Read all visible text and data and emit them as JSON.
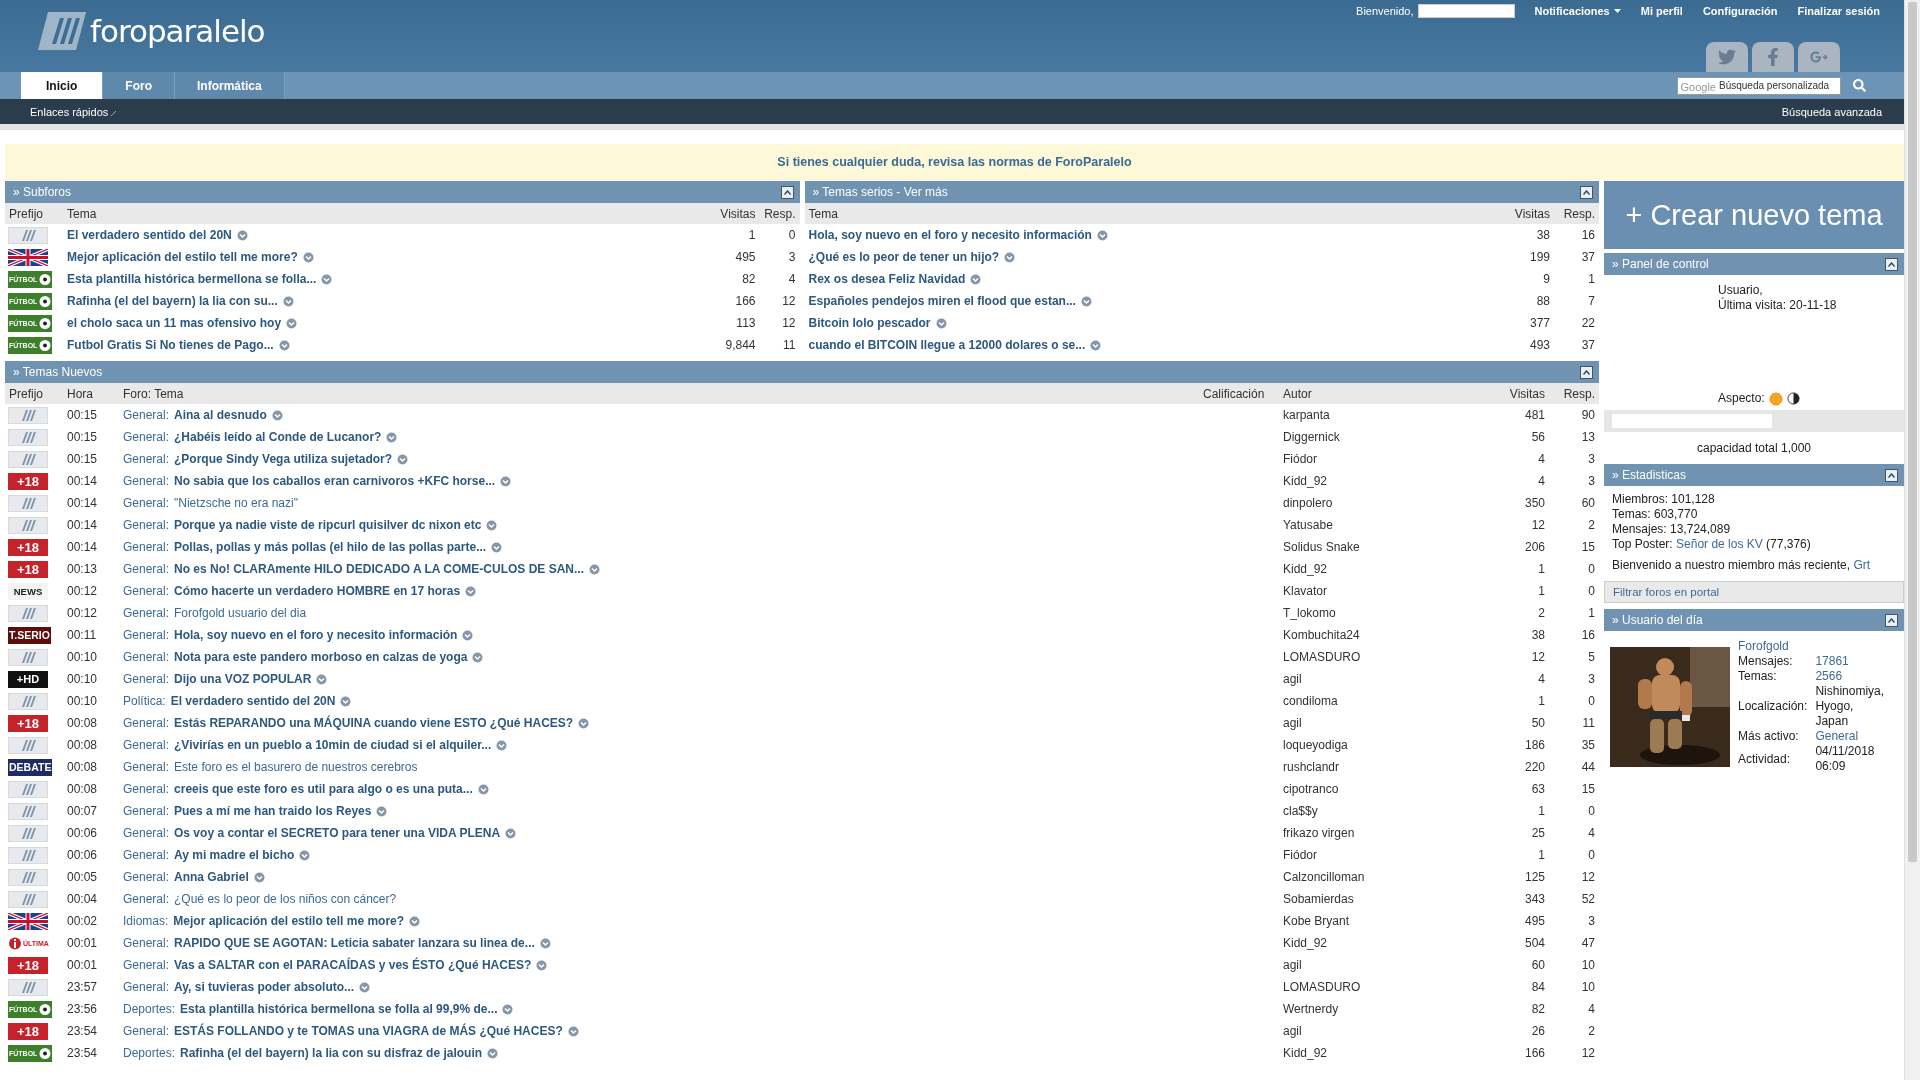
{
  "header": {
    "logo": "foroparalelo",
    "welcome": "Bienvenido,",
    "links": [
      {
        "label": "Notificaciones",
        "kind": "menu"
      },
      {
        "label": "Mi perfil",
        "kind": "link"
      },
      {
        "label": "Configuración",
        "kind": "link"
      },
      {
        "label": "Finalizar sesión",
        "kind": "link"
      }
    ]
  },
  "tabs": [
    {
      "label": "Inicio",
      "selected": true
    },
    {
      "label": "Foro",
      "selected": false
    },
    {
      "label": "Informática",
      "selected": false
    }
  ],
  "search": {
    "brand": "Google",
    "placeholder": "Búsqueda personalizada"
  },
  "navbar": {
    "quick_links": "Enlaces rápidos",
    "advanced_search": "Búsqueda avanzada"
  },
  "notice": "Si tienes cualquier duda, revisa las normas de ForoParalelo",
  "subforos": {
    "title": "» Subforos",
    "columns": [
      "Prefijo",
      "Tema",
      "Visitas",
      "Resp."
    ],
    "rows": [
      {
        "prefix": {
          "kind": "default"
        },
        "title": "El verdadero sentido del 20N",
        "visits": "1",
        "replies": "0"
      },
      {
        "prefix": {
          "kind": "uk"
        },
        "title": "Mejor aplicación del estilo tell me more?",
        "visits": "495",
        "replies": "3"
      },
      {
        "prefix": {
          "kind": "futbol",
          "label": "FÚTBOL"
        },
        "title": "Esta plantilla histórica bermellona se folla...",
        "visits": "82",
        "replies": "4"
      },
      {
        "prefix": {
          "kind": "futbol",
          "label": "FÚTBOL"
        },
        "title": "Rafinha (el del bayern) la lia con su...",
        "visits": "166",
        "replies": "12"
      },
      {
        "prefix": {
          "kind": "futbol",
          "label": "FÚTBOL"
        },
        "title": "el cholo saca un 11 mas ofensivo hoy",
        "visits": "113",
        "replies": "12"
      },
      {
        "prefix": {
          "kind": "futbol",
          "label": "FÚTBOL"
        },
        "title": "Futbol Gratis Si No tienes de Pago...",
        "visits": "9,844",
        "replies": "11"
      }
    ]
  },
  "temas_serios": {
    "title": "» Temas serios - Ver más",
    "columns": [
      "Tema",
      "Visitas",
      "Resp."
    ],
    "rows": [
      {
        "title": "Hola, soy nuevo en el foro y necesito información",
        "visits": "38",
        "replies": "16"
      },
      {
        "title": "¿Qué es lo peor de tener un hijo?",
        "visits": "199",
        "replies": "37"
      },
      {
        "title": "Rex os desea Feliz Navidad",
        "visits": "9",
        "replies": "1"
      },
      {
        "title": "Españoles pendejos miren el flood que estan...",
        "visits": "88",
        "replies": "7"
      },
      {
        "title": "Bitcoin lolo pescador",
        "visits": "377",
        "replies": "22"
      },
      {
        "title": "cuando el BITCOIN llegue a 12000 dolares o se...",
        "visits": "493",
        "replies": "37"
      }
    ]
  },
  "temas_nuevos": {
    "title": "» Temas Nuevos",
    "columns": [
      "Prefijo",
      "Hora",
      "Foro: Tema",
      "Calificación",
      "Autor",
      "Visitas",
      "Resp."
    ],
    "rows": [
      {
        "prefix": {
          "kind": "default"
        },
        "time": "00:15",
        "forum": "General:",
        "title": "Aina al desnudo",
        "unread": true,
        "author": "karpanta",
        "visits": "481",
        "replies": "90"
      },
      {
        "prefix": {
          "kind": "default"
        },
        "time": "00:15",
        "forum": "General:",
        "title": "¿Habéis leído al Conde de Lucanor?",
        "unread": true,
        "author": "Diggernick",
        "visits": "56",
        "replies": "13"
      },
      {
        "prefix": {
          "kind": "default"
        },
        "time": "00:15",
        "forum": "General:",
        "title": "¿Porque Sindy Vega utiliza sujetador?",
        "unread": true,
        "author": "Fiódor",
        "visits": "4",
        "replies": "3"
      },
      {
        "prefix": {
          "kind": "plus18",
          "label": "+18"
        },
        "time": "00:14",
        "forum": "General:",
        "title": "No sabia que los caballos eran carnivoros +KFC horse...",
        "unread": true,
        "author": "Kidd_92",
        "visits": "4",
        "replies": "3"
      },
      {
        "prefix": {
          "kind": "default"
        },
        "time": "00:14",
        "forum": "General:",
        "title": "\"Nietzsche no era nazi\"",
        "unread": false,
        "author": "dinpolero",
        "visits": "350",
        "replies": "60"
      },
      {
        "prefix": {
          "kind": "default"
        },
        "time": "00:14",
        "forum": "General:",
        "title": "Porque ya nadie viste de ripcurl quisilver dc nixon etc",
        "unread": true,
        "author": "Yatusabe",
        "visits": "12",
        "replies": "2"
      },
      {
        "prefix": {
          "kind": "plus18",
          "label": "+18"
        },
        "time": "00:14",
        "forum": "General:",
        "title": "Pollas, pollas y más pollas (el hilo de las pollas parte...",
        "unread": true,
        "author": "Solidus Snake",
        "visits": "206",
        "replies": "15"
      },
      {
        "prefix": {
          "kind": "plus18",
          "label": "+18"
        },
        "time": "00:13",
        "forum": "General:",
        "title": "No es No! CLARAmente HILO DEDICADO A LA COME-CULOS DE SAN...",
        "unread": true,
        "author": "Kidd_92",
        "visits": "1",
        "replies": "0"
      },
      {
        "prefix": {
          "kind": "news",
          "label": "NEWS"
        },
        "time": "00:12",
        "forum": "General:",
        "title": "Cómo hacerte un verdadero HOMBRE en 17 horas",
        "unread": true,
        "author": "Klavator",
        "visits": "1",
        "replies": "0"
      },
      {
        "prefix": {
          "kind": "default"
        },
        "time": "00:12",
        "forum": "General:",
        "title": "Forofgold usuario del dia",
        "unread": false,
        "author": "T_lokomo",
        "visits": "2",
        "replies": "1"
      },
      {
        "prefix": {
          "kind": "tserio",
          "label": "T.SERIO"
        },
        "time": "00:11",
        "forum": "General:",
        "title": "Hola, soy nuevo en el foro y necesito información",
        "unread": true,
        "author": "Kombuchita24",
        "visits": "38",
        "replies": "16"
      },
      {
        "prefix": {
          "kind": "default"
        },
        "time": "00:10",
        "forum": "General:",
        "title": "Nota para este pandero morboso en calzas de yoga",
        "unread": true,
        "author": "LOMASDURO",
        "visits": "12",
        "replies": "5"
      },
      {
        "prefix": {
          "kind": "hd",
          "label": "+HD"
        },
        "time": "00:10",
        "forum": "General:",
        "title": "Dijo una VOZ POPULAR",
        "unread": true,
        "author": "agil",
        "visits": "4",
        "replies": "3"
      },
      {
        "prefix": {
          "kind": "default"
        },
        "time": "00:10",
        "forum": "Política:",
        "title": "El verdadero sentido del 20N",
        "unread": true,
        "author": "condiloma",
        "visits": "1",
        "replies": "0"
      },
      {
        "prefix": {
          "kind": "plus18",
          "label": "+18"
        },
        "time": "00:08",
        "forum": "General:",
        "title": "Estás REPARANDO una MÁQUINA cuando viene ESTO ¿Qué HACES?",
        "unread": true,
        "author": "agil",
        "visits": "50",
        "replies": "11"
      },
      {
        "prefix": {
          "kind": "default"
        },
        "time": "00:08",
        "forum": "General:",
        "title": "¿Vivirías en un pueblo a 10min de ciudad si el alquiler...",
        "unread": true,
        "author": "loqueyodiga",
        "visits": "186",
        "replies": "35"
      },
      {
        "prefix": {
          "kind": "debate",
          "label": "DEBATE"
        },
        "time": "00:08",
        "forum": "General:",
        "title": "Este foro es el basurero de nuestros cerebros",
        "unread": false,
        "author": "rushclandr",
        "visits": "220",
        "replies": "44"
      },
      {
        "prefix": {
          "kind": "default"
        },
        "time": "00:08",
        "forum": "General:",
        "title": "creeis que este foro es util para algo o es una puta...",
        "unread": true,
        "author": "cipotranco",
        "visits": "63",
        "replies": "15"
      },
      {
        "prefix": {
          "kind": "default"
        },
        "time": "00:07",
        "forum": "General:",
        "title": "Pues a mí me han traido los Reyes",
        "unread": true,
        "author": "cla$$y",
        "visits": "1",
        "replies": "0"
      },
      {
        "prefix": {
          "kind": "default"
        },
        "time": "00:06",
        "forum": "General:",
        "title": "Os voy a contar el SECRETO para tener una VIDA PLENA",
        "unread": true,
        "author": "frikazo virgen",
        "visits": "25",
        "replies": "4"
      },
      {
        "prefix": {
          "kind": "default"
        },
        "time": "00:06",
        "forum": "General:",
        "title": "Ay mi madre el bicho",
        "unread": true,
        "author": "Fiódor",
        "visits": "1",
        "replies": "0"
      },
      {
        "prefix": {
          "kind": "default"
        },
        "time": "00:05",
        "forum": "General:",
        "title": "Anna Gabriel",
        "unread": true,
        "author": "Calzoncilloman",
        "visits": "125",
        "replies": "12"
      },
      {
        "prefix": {
          "kind": "default"
        },
        "time": "00:04",
        "forum": "General:",
        "title": "¿Qué es lo peor de los niños con cáncer?",
        "unread": false,
        "author": "Sobamierdas",
        "visits": "343",
        "replies": "52"
      },
      {
        "prefix": {
          "kind": "uk"
        },
        "time": "00:02",
        "forum": "Idiomas:",
        "title": "Mejor aplicación del estilo tell me more?",
        "unread": true,
        "author": "Kobe Bryant",
        "visits": "495",
        "replies": "3"
      },
      {
        "prefix": {
          "kind": "ultima",
          "label": "ÚLTIMA"
        },
        "time": "00:01",
        "forum": "General:",
        "title": "RAPIDO QUE SE AGOTAN: Leticia sabater lanzara su linea de...",
        "unread": true,
        "author": "Kidd_92",
        "visits": "504",
        "replies": "47"
      },
      {
        "prefix": {
          "kind": "plus18",
          "label": "+18"
        },
        "time": "00:01",
        "forum": "General:",
        "title": "Vas a SALTAR con el PARACAÍDAS y ves ÉSTO ¿Qué HACES?",
        "unread": true,
        "author": "agil",
        "visits": "60",
        "replies": "10"
      },
      {
        "prefix": {
          "kind": "default"
        },
        "time": "23:57",
        "forum": "General:",
        "title": "Ay, si tuvieras poder absoluto...",
        "unread": true,
        "author": "LOMASDURO",
        "visits": "84",
        "replies": "10"
      },
      {
        "prefix": {
          "kind": "futbol",
          "label": "FÚTBOL"
        },
        "time": "23:56",
        "forum": "Deportes:",
        "title": "Esta plantilla histórica bermellona se folla al 99,9% de...",
        "unread": true,
        "author": "Wertnerdy",
        "visits": "82",
        "replies": "4"
      },
      {
        "prefix": {
          "kind": "plus18",
          "label": "+18"
        },
        "time": "23:54",
        "forum": "General:",
        "title": "ESTÁS FOLLANDO y te TOMAS una VIAGRA de MÁS ¿Qué HACES?",
        "unread": true,
        "author": "agil",
        "visits": "26",
        "replies": "2"
      },
      {
        "prefix": {
          "kind": "futbol",
          "label": "FÚTBOL"
        },
        "time": "23:54",
        "forum": "Deportes:",
        "title": "Rafinha (el del bayern) la lia con su disfraz de jalouin",
        "unread": true,
        "author": "Kidd_92",
        "visits": "166",
        "replies": "12"
      }
    ]
  },
  "sidebar": {
    "create_button": "+ Crear nuevo tema",
    "control_panel": {
      "title": "» Panel de control",
      "user": "Usuario,",
      "last_visit": "Última visita: 20-11-18",
      "aspect": "Aspecto:",
      "capacity": "capacidad total 1,000"
    },
    "stats": {
      "title": "» Estadisticas",
      "lines": [
        {
          "text": "Miembros: 101,128"
        },
        {
          "text": "Temas: 603,770"
        },
        {
          "text": "Mensajes: 13,724,089"
        },
        {
          "text": "Top Poster: ",
          "link": "Señor de los KV",
          "after": " (77,376)"
        }
      ],
      "newest": {
        "text": "Bienvenido a nuestro miembro más reciente, ",
        "link": "Grt"
      }
    },
    "filter": "Filtrar foros en portal",
    "user_of_day": {
      "title": "» Usuario del día",
      "name": "Forofgold",
      "fields": [
        {
          "label": "Mensajes:",
          "value": "17861",
          "link": true
        },
        {
          "label": "Temas:",
          "value": "2566",
          "link": true
        },
        {
          "label": "Localización:",
          "value": "Nishinomiya, Hyogo, Japan",
          "link": false
        },
        {
          "label": "Más activo:",
          "value": "General",
          "link": true
        },
        {
          "label": "Actividad:",
          "value": "04/11/2018 06:09",
          "link": false
        }
      ]
    }
  }
}
